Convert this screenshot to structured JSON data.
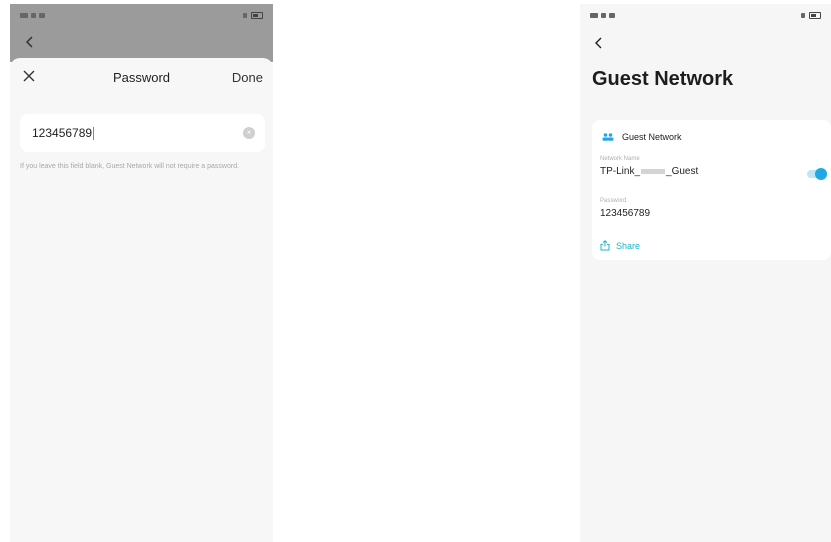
{
  "left_screen": {
    "status_bar": {
      "left": "",
      "right": ""
    },
    "sheet": {
      "title": "Password",
      "done_label": "Done"
    },
    "password_field": {
      "value": "123456789"
    },
    "hint": "If you leave this field blank, Guest Network will not require a password."
  },
  "right_screen": {
    "page_title": "Guest Network",
    "card": {
      "heading": "Guest Network",
      "network_name_label": "Network Name",
      "network_name_prefix": "TP-Link_",
      "network_name_suffix": "_Guest",
      "toggle_on": true,
      "password_label": "Password",
      "password_value": "123456789",
      "share_label": "Share"
    }
  },
  "colors": {
    "accent": "#21a7e6",
    "share": "#20b4c8",
    "dim_overlay": "#9b9b9b"
  }
}
